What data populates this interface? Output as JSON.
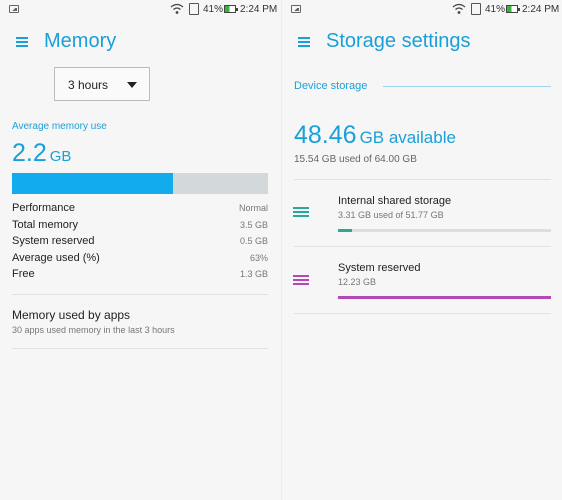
{
  "status_bar": {
    "battery": "41%",
    "time": "2:24 PM"
  },
  "memory": {
    "title": "Memory",
    "timeframe": "3 hours",
    "avg_label": "Average memory use",
    "avg_value": "2.2",
    "avg_unit": "GB",
    "usage_fraction": 0.63,
    "stats": [
      {
        "label": "Performance",
        "value": "Normal"
      },
      {
        "label": "Total memory",
        "value": "3.5 GB"
      },
      {
        "label": "System reserved",
        "value": "0.5 GB"
      },
      {
        "label": "Average used (%)",
        "value": "63%"
      },
      {
        "label": "Free",
        "value": "1.3 GB"
      }
    ],
    "apps": {
      "title": "Memory used by apps",
      "subtitle": "30 apps used memory in the last 3 hours"
    }
  },
  "storage": {
    "title": "Storage settings",
    "section": "Device storage",
    "available_value": "48.46",
    "available_unit": "GB available",
    "used_text": "15.54 GB used of 64.00 GB",
    "items": [
      {
        "title": "Internal shared storage",
        "subtitle": "3.31 GB used of 51.77 GB",
        "fraction": 0.064,
        "color": "#2aa897",
        "icon": "storage-list-icon"
      },
      {
        "title": "System reserved",
        "subtitle": "12.23 GB",
        "fraction": 1.0,
        "color": "#b348b8",
        "icon": "storage-list-icon"
      }
    ]
  },
  "colors": {
    "accent": "#1aa0d8",
    "memory_bar": "#12acec",
    "track": "#d3d8db"
  }
}
